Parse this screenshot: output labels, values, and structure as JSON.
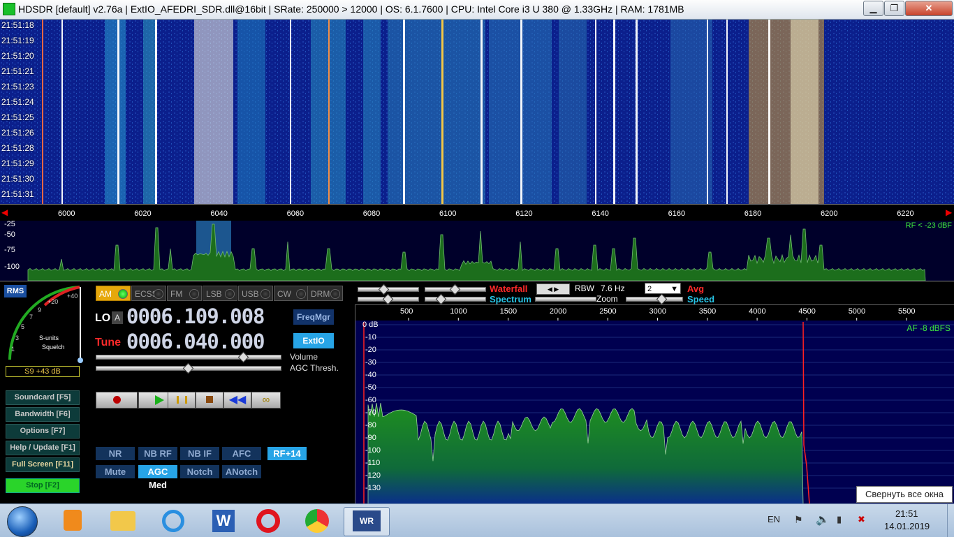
{
  "titlebar": {
    "title": "HDSDR  [default]  v2.76a   |  ExtIO_AFEDRI_SDR.dll@16bit  |  SRate: 250000 > 12000  |  OS: 6.1.7600   |  CPU: Intel Core i3          U 380  @ 1.33GHz  |  RAM: 1781MB",
    "minimize": "▁",
    "maximize": "❐",
    "close": "✕"
  },
  "waterfall": {
    "times": [
      "21:51:18",
      "21:51:19",
      "21:51:20",
      "21:51:21",
      "21:51:23",
      "21:51:24",
      "21:51:25",
      "21:51:26",
      "21:51:28",
      "21:51:29",
      "21:51:30",
      "21:51:31"
    ]
  },
  "freq_axis": {
    "ticks": [
      "6000",
      "6020",
      "6040",
      "6060",
      "6080",
      "6100",
      "6120",
      "6140",
      "6160",
      "6180",
      "6200",
      "6220"
    ]
  },
  "spectrum": {
    "db_labels": [
      "-25",
      "-50",
      "-75",
      "-100"
    ],
    "rf_level": "RF < -23 dBF"
  },
  "rms": {
    "label": "RMS",
    "smeter_labels": [
      "1",
      "3",
      "5",
      "7",
      "9",
      "+20",
      "+40"
    ],
    "s_units": "S-units",
    "squelch": "Squelch",
    "reading": "S9 +43 dB"
  },
  "modes": [
    {
      "label": "AM",
      "active": true
    },
    {
      "label": "ECSS",
      "active": false
    },
    {
      "label": "FM",
      "active": false
    },
    {
      "label": "LSB",
      "active": false
    },
    {
      "label": "USB",
      "active": false
    },
    {
      "label": "CW",
      "active": false
    },
    {
      "label": "DRM",
      "active": false
    }
  ],
  "lo": {
    "label": "LO",
    "badge": "A",
    "value": "0006.109.008"
  },
  "tune": {
    "label": "Tune",
    "value": "0006.040.000"
  },
  "buttons": {
    "freqmgr": "FreqMgr",
    "extio": "ExtIO",
    "volume": "Volume",
    "agc_thresh": "AGC Thresh."
  },
  "volume_level": 0.8,
  "agc_level": 0.5,
  "side_buttons": [
    {
      "label": "Soundcard  [F5]"
    },
    {
      "label": "Bandwidth  [F6]"
    },
    {
      "label": "Options  [F7]"
    },
    {
      "label": "Help / Update  [F1]"
    },
    {
      "label": "Full Screen  [F11]"
    },
    {
      "label": "Stop  [F2]"
    }
  ],
  "dsp": {
    "row1": [
      "NR",
      "NB RF",
      "NB IF",
      "AFC",
      "RF+14"
    ],
    "row2": [
      "Mute",
      "AGC Med",
      "Notch",
      "ANotch"
    ]
  },
  "audio_controls": {
    "waterfall": "Waterfall",
    "spectrum": "Spectrum",
    "rbw_label": "RBW",
    "rbw_value": "7.6 Hz",
    "avg_value": "2",
    "avg_label": "Avg",
    "zoom": "Zoom",
    "speed": "Speed"
  },
  "af_display": {
    "freq_ticks": [
      "500",
      "1000",
      "1500",
      "2000",
      "2500",
      "3000",
      "3500",
      "4000",
      "4500",
      "5000",
      "5500"
    ],
    "db_ticks": [
      "0 dB",
      "-10",
      "-20",
      "-30",
      "-40",
      "-50",
      "-60",
      "-70",
      "-80",
      "-90",
      "-100",
      "-110",
      "-120",
      "-130"
    ],
    "af_level": "AF  -8 dBFS"
  },
  "colors": {
    "waterfall_bg": "#0a1a7a",
    "spectrum_green": "#1f7a1f",
    "red_marker": "#ff2020",
    "accent_cyan": "#27c6e8",
    "stop_green": "#2ad42a"
  },
  "tray": {
    "lang": "EN",
    "time": "21:51",
    "date": "14.01.2019",
    "tooltip": "Свернуть все окна"
  }
}
